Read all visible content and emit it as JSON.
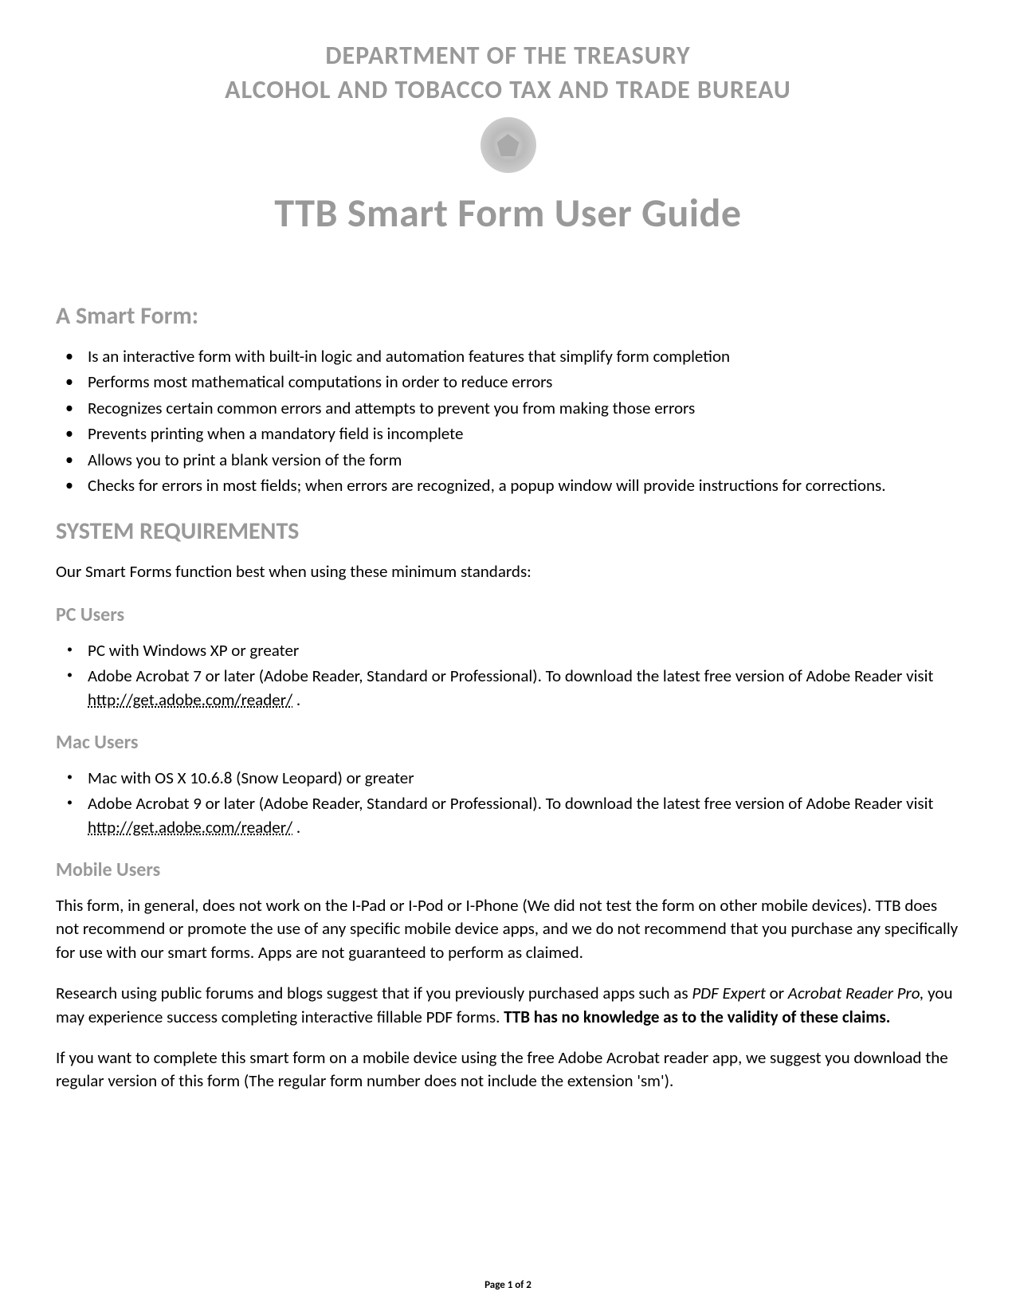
{
  "header": {
    "dept_line1": "DEPARTMENT OF THE TREASURY",
    "dept_line2": "ALCOHOL AND TOBACCO TAX AND TRADE BUREAU",
    "main_title": "TTB Smart Form User Guide"
  },
  "smart_form": {
    "heading": "A Smart Form:",
    "bullets": [
      "Is an interactive form with built-in logic and automation features that simplify form completion",
      "Performs most mathematical computations in order to reduce errors",
      "Recognizes certain common errors and attempts to prevent you from making those errors",
      "Prevents printing when a mandatory field is incomplete",
      "Allows you to print a blank version of the form",
      "Checks for errors in most fields; when errors are recognized, a popup window will provide instructions for corrections."
    ]
  },
  "system_req": {
    "heading": "SYSTEM REQUIREMENTS",
    "intro": "Our Smart Forms function best when using these minimum standards:"
  },
  "pc_users": {
    "heading": "PC Users",
    "bullets": {
      "b0": "PC with Windows XP or greater",
      "b1_prefix": "Adobe Acrobat 7 or later (Adobe Reader, Standard or Professional).  To download the latest free version of Adobe Reader visit ",
      "b1_link": "http://get.adobe.com/reader/",
      "b1_suffix": " ."
    }
  },
  "mac_users": {
    "heading": "Mac Users",
    "bullets": {
      "b0": "Mac with OS X 10.6.8 (Snow Leopard) or greater",
      "b1_prefix": "Adobe Acrobat 9 or later (Adobe Reader, Standard or Professional).  To download the latest free version of Adobe Reader visit ",
      "b1_link": "http://get.adobe.com/reader/",
      "b1_suffix": " ."
    }
  },
  "mobile_users": {
    "heading": "Mobile Users",
    "para1": "This form, in general, does not work on the I-Pad or I-Pod or I-Phone (We did not test the form on other mobile devices). TTB does not recommend or promote the use of any specific mobile device apps, and we do not recommend that you purchase any specifically for use with our smart forms. Apps are not guaranteed to perform as claimed.",
    "para2_prefix": "Research using public forums and blogs suggest that if you previously purchased apps such as ",
    "para2_italic1": "PDF Expert",
    "para2_mid": " or ",
    "para2_italic2": "Acrobat Reader Pro,",
    "para2_after_italic": " you may experience success completing interactive fillable PDF forms. ",
    "para2_bold": "TTB has no knowledge as to the validity of these claims.",
    "para3": "If you want to complete this smart form on a mobile device using the free Adobe Acrobat reader app, we suggest you download the regular version of this form (The regular form number does not include the extension 'sm')."
  },
  "footer": {
    "page_text": "Page 1 of 2"
  }
}
